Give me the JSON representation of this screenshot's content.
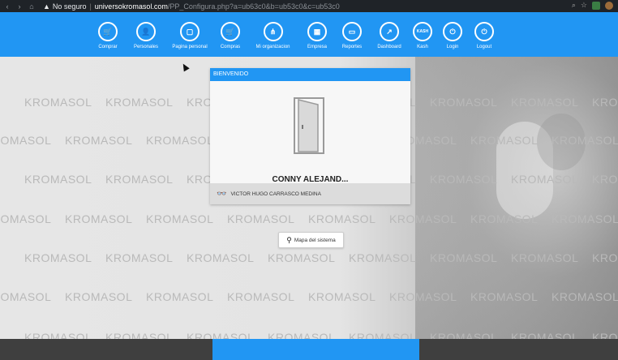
{
  "browser": {
    "security_warning": "No seguro",
    "url_host": "universokromasol.com",
    "url_path": "/PP_Configura.php?a=ub63c0&b=ub53c0&c=ub53c0"
  },
  "nav": {
    "items": [
      {
        "label": "Comprar",
        "icon": "cart-icon",
        "glyph": "🛒"
      },
      {
        "label": "Personales",
        "icon": "user-icon",
        "glyph": "👤"
      },
      {
        "label": "Pagina personal",
        "icon": "page-icon",
        "glyph": "▢"
      },
      {
        "label": "Compras",
        "icon": "basket-icon",
        "glyph": "🛒"
      },
      {
        "label": "Mi organizacion",
        "icon": "org-icon",
        "glyph": "⋔"
      },
      {
        "label": "Empresa",
        "icon": "building-icon",
        "glyph": "▦"
      },
      {
        "label": "Reportes",
        "icon": "report-icon",
        "glyph": "▭"
      },
      {
        "label": "Dashboard",
        "icon": "dashboard-icon",
        "glyph": "↗"
      },
      {
        "label": "Kash",
        "icon": "kash-icon",
        "glyph": "KASH"
      },
      {
        "label": "Login",
        "icon": "power-icon",
        "glyph": "⏻"
      },
      {
        "label": "Logout",
        "icon": "power-icon",
        "glyph": "⏻"
      }
    ]
  },
  "watermark": "KROMASOL",
  "panel": {
    "header": "BIENVENIDO",
    "user_name": "CONNY ALEJAND...",
    "full_name": "VICTOR HUGO CARRASCO MEDINA"
  },
  "site_map_label": "Mapa del sistema",
  "colors": {
    "accent": "#2196f3",
    "footer": "#3f3f3f"
  }
}
